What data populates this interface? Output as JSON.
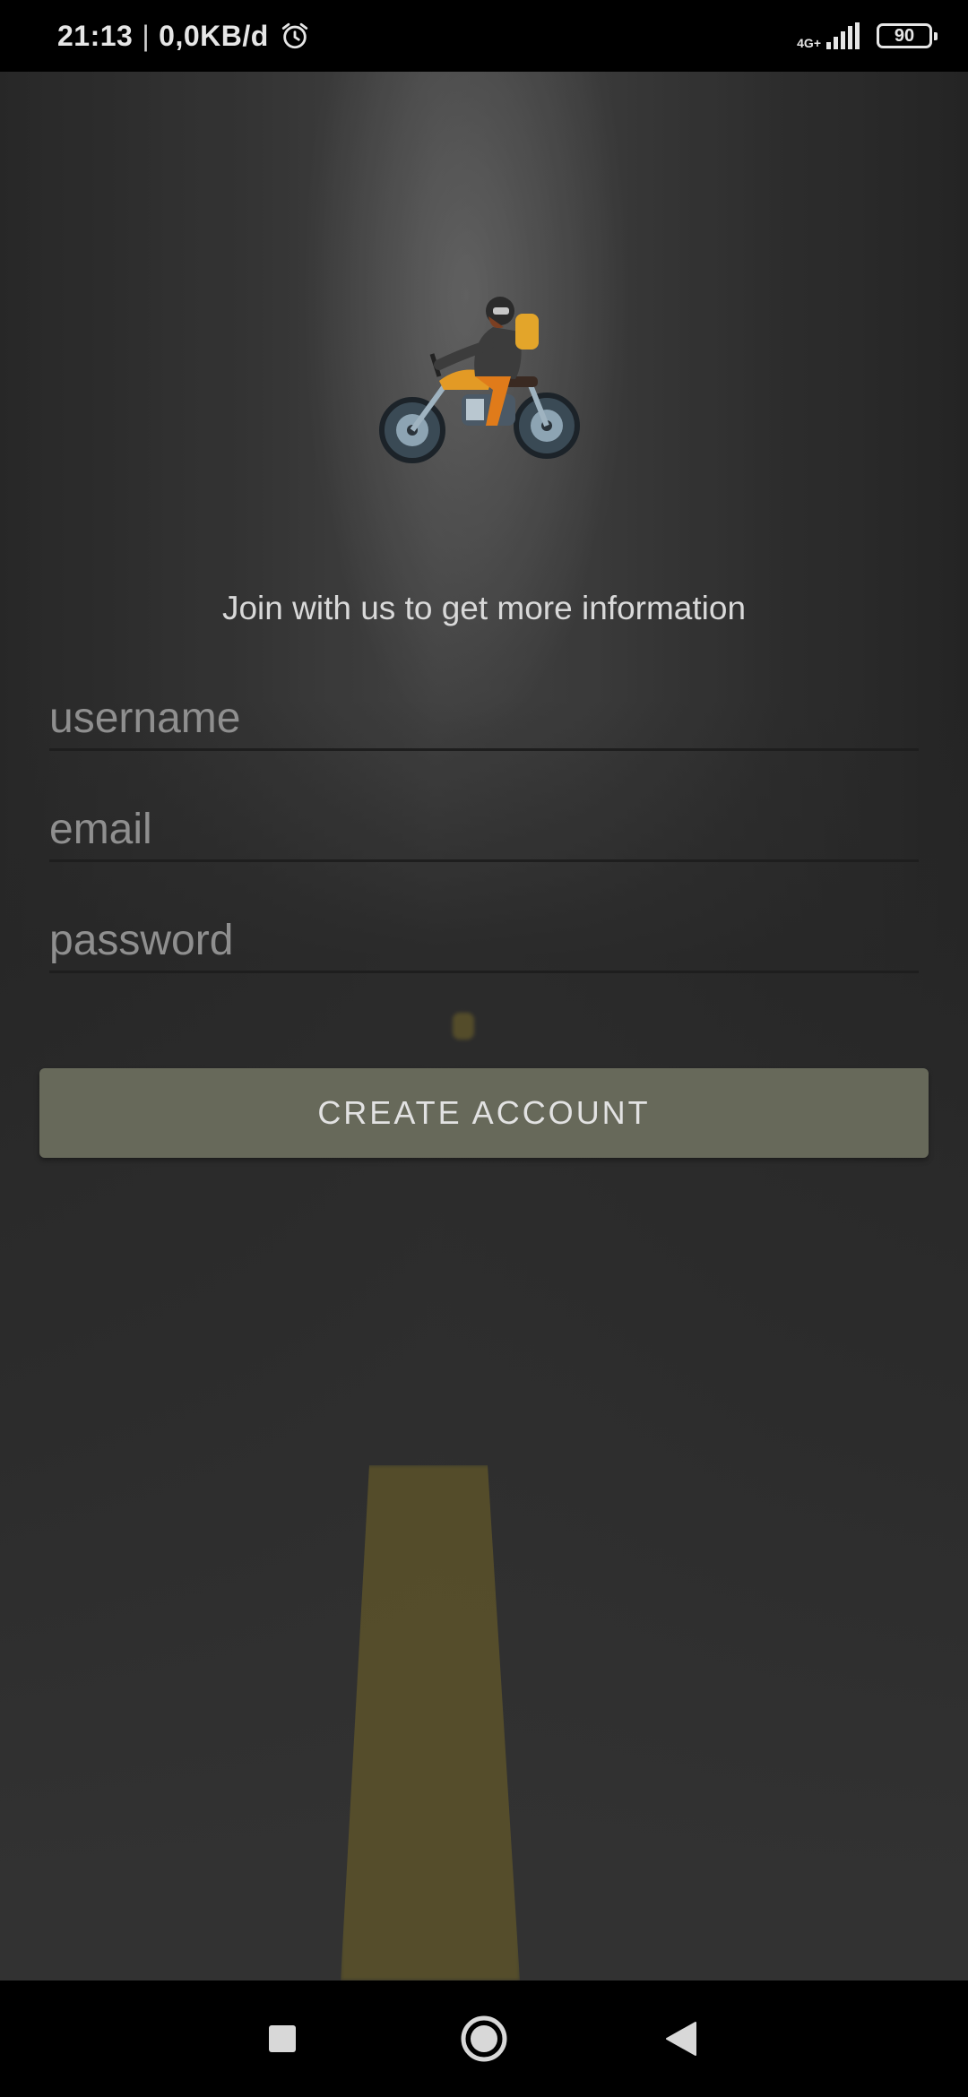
{
  "status_bar": {
    "time": "21:13",
    "network_speed": "0,0KB/d",
    "separator": "|",
    "network_type": "4G+",
    "battery": "90",
    "alarm_icon": "alarm-clock-icon",
    "signal_icon": "signal-bars-icon"
  },
  "app": {
    "logo_icon": "motorcycle-rider-illustration",
    "tagline": "Join with us to get more information",
    "form": {
      "username_placeholder": "username",
      "email_placeholder": "email",
      "password_placeholder": "password",
      "submit_label": "CREATE ACCOUNT"
    },
    "colors": {
      "button": "#67695a",
      "button_text": "#e2e2e2",
      "placeholder": "#8f8f8f",
      "underline": "#1e1e1e",
      "lane_line": "#6c6130"
    }
  },
  "nav_bar": {
    "recents_icon": "square-recents-icon",
    "home_icon": "circle-home-icon",
    "back_icon": "triangle-back-icon"
  }
}
